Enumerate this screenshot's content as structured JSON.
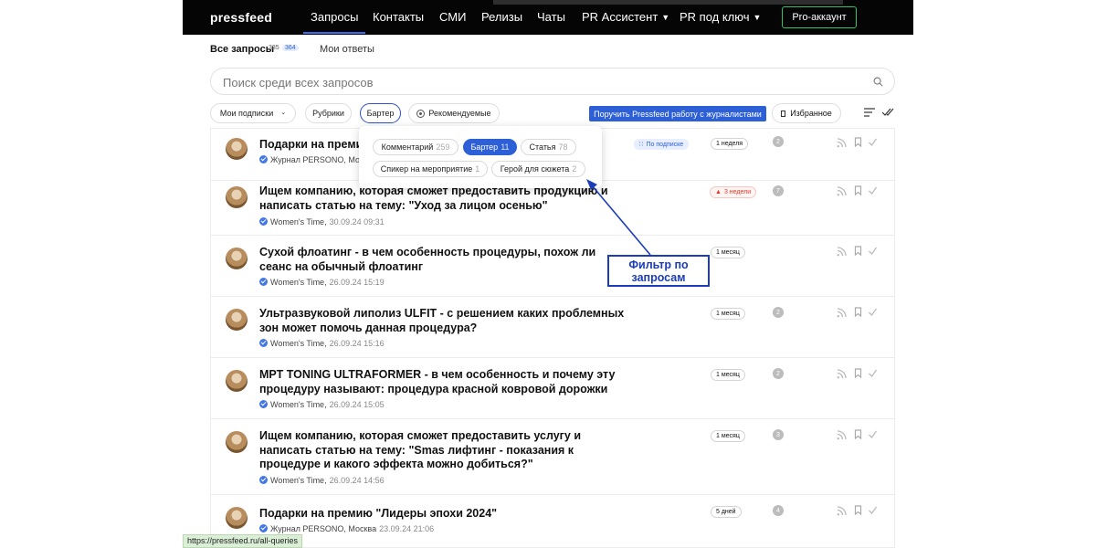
{
  "nav": {
    "logo": "pressfeed",
    "items": [
      {
        "label": "Запросы"
      },
      {
        "label": "Контакты"
      },
      {
        "label": "СМИ"
      },
      {
        "label": "Релизы"
      },
      {
        "label": "Чаты"
      },
      {
        "label": "PR Ассистент"
      },
      {
        "label": "PR под ключ"
      }
    ],
    "pro_button": "Pro-аккаунт"
  },
  "subtabs": {
    "all": {
      "label": "Все запросы",
      "count_total": "385",
      "count_new": "364"
    },
    "mine": {
      "label": "Мои ответы"
    }
  },
  "search": {
    "placeholder": "Поиск среди всех запросов"
  },
  "filters": {
    "subscriptions": "Мои подписки",
    "rubrics": "Рубрики",
    "barter": "Бартер",
    "recommended": "Рекомендуемые",
    "ask_button": "Поручить Pressfeed работу с журналистами",
    "favorites": "Избранное"
  },
  "popup": {
    "chips": [
      {
        "label": "Комментарий",
        "count": "259"
      },
      {
        "label": "Бартер",
        "count": "11",
        "active": true
      },
      {
        "label": "Статья",
        "count": "78"
      },
      {
        "label": "Спикер на мероприятие",
        "count": "1"
      },
      {
        "label": "Герой для сюжета",
        "count": "2"
      }
    ]
  },
  "rows": [
    {
      "title": "Подарки на премию",
      "source": "Журнал PERSONO, Москва",
      "date": "",
      "tag": "По подписке",
      "time": "1 неделя",
      "count": "2",
      "hot": false
    },
    {
      "title": "Ищем компанию, которая сможет предоставить продукцию и написать статью на тему: \"Уход за лицом осенью\"",
      "source": "Women's Time,",
      "date": "30.09.24 09:31",
      "tag": "",
      "time": "3 недели",
      "count": "7",
      "hot": true
    },
    {
      "title": "Сухой флоатинг - в чем особенность процедуры, похож ли сеанс на обычный флоатинг",
      "source": "Women's Time,",
      "date": "26.09.24 15:19",
      "tag": "",
      "time": "1 месяц",
      "count": "",
      "hot": false
    },
    {
      "title": "Ультразвуковой липолиз ULFIT - с решением каких проблемных зон может помочь данная процедура?",
      "source": "Women's Time,",
      "date": "26.09.24 15:16",
      "tag": "",
      "time": "1 месяц",
      "count": "2",
      "hot": false
    },
    {
      "title": "МРТ TONING ULTRAFORMER - в чем особенность и почему эту процедуру называют: процедура красной ковровой дорожки",
      "source": "Women's Time,",
      "date": "26.09.24 15:05",
      "tag": "",
      "time": "1 месяц",
      "count": "2",
      "hot": false
    },
    {
      "title": "Ищем компанию, которая сможет предоставить услугу и написать статью на тему: \"Smas лифтинг - показания к процедуре и какого эффекта можно добиться?\"",
      "source": "Women's Time,",
      "date": "26.09.24 14:56",
      "tag": "",
      "time": "1 месяц",
      "count": "3",
      "hot": false
    },
    {
      "title": "Подарки на премию \"Лидеры эпохи 2024\"",
      "source": "Журнал PERSONO, Москва",
      "date": "23.09.24 21:06",
      "tag": "",
      "time": "5 дней",
      "count": "4",
      "hot": false
    }
  ],
  "annotation": {
    "line1": "Фильтр по",
    "line2": "запросам"
  },
  "status_url": "https://pressfeed.ru/all-queries",
  "colors": {
    "accent": "#2d5fd6",
    "pro_border": "#34c26b",
    "annotation": "#1b3db7",
    "hot": "#e0392c"
  }
}
